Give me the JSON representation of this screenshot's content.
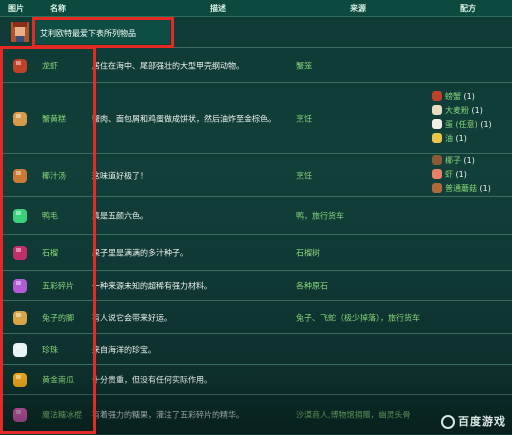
{
  "header": {
    "image": "图片",
    "name": "名称",
    "description": "描述",
    "source": "来源",
    "recipe": "配方"
  },
  "title_note": "艾利欧特最爱下表所列物品",
  "rows": [
    {
      "icon": "lobster-icon",
      "color": "#c0412a",
      "name": "龙虾",
      "desc": "居住在海中、尾部强壮的大型甲壳纲动物。",
      "src": "蟹笼"
    },
    {
      "icon": "crab-cakes-icon",
      "color": "#d69a4c",
      "name": "蟹黄糕",
      "desc": "蟹肉、面包屑和鸡蛋做成饼状，然后油炸至金棕色。",
      "src": "烹饪"
    },
    {
      "icon": "coconut-soup-icon",
      "color": "#c97a34",
      "name": "椰汁汤",
      "desc": "这味道好极了！",
      "src": "烹饪"
    },
    {
      "icon": "duck-feather-icon",
      "color": "#3bd07a",
      "name": "鸭毛",
      "desc": "真是五颜六色。",
      "src": "鸭，旅行货车"
    },
    {
      "icon": "pomegranate-icon",
      "color": "#c12f6a",
      "name": "石榴",
      "desc": "果子里是满满的多汁种子。",
      "src": "石榴树"
    },
    {
      "icon": "prismatic-shard-icon",
      "color": "#b35ad6",
      "name": "五彩碎片",
      "desc": "一种来源未知的超稀有强力材料。",
      "src": "各种原石"
    },
    {
      "icon": "rabbits-foot-icon",
      "color": "#d7a44a",
      "name": "兔子的脚",
      "desc": "有人说它会带来好运。",
      "src": "兔子、飞蛇（极少掉落），旅行货车"
    },
    {
      "icon": "pearl-icon",
      "color": "#e8f3f6",
      "name": "珍珠",
      "desc": "来自海洋的珍宝。",
      "src": ""
    },
    {
      "icon": "golden-pumpkin-icon",
      "color": "#e8a41d",
      "name": "黄金南瓜",
      "desc": "十分贵重，但没有任何实际作用。",
      "src": ""
    },
    {
      "icon": "rock-candy-icon",
      "color": "#ec5ac0",
      "name": "魔法糖冰棍",
      "desc": "有着强力的糖果，灌注了五彩碎片的精华。",
      "src": "沙漠商人,博物馆捐赠，幽灵头骨"
    }
  ],
  "recipes": [
    {
      "row": 1,
      "items": [
        {
          "label": "螃蟹",
          "qty": "(1)",
          "color": "#c0412a",
          "icon": "crab-icon"
        },
        {
          "label": "大麦粉",
          "qty": "(1)",
          "color": "#e8dcc0",
          "icon": "wheat-flour-icon"
        },
        {
          "label": "蛋 (任意)",
          "qty": "(1)",
          "color": "#f2f0e6",
          "icon": "egg-icon"
        },
        {
          "label": "油",
          "qty": "(1)",
          "color": "#e8c44a",
          "icon": "oil-icon"
        }
      ]
    },
    {
      "row": 2,
      "items": [
        {
          "label": "椰子",
          "qty": "(1)",
          "color": "#8a5a34",
          "icon": "coconut-icon"
        },
        {
          "label": "虾",
          "qty": "(1)",
          "color": "#e8806a",
          "icon": "shrimp-icon"
        },
        {
          "label": "普通蘑菇",
          "qty": "(1)",
          "color": "#b06a3a",
          "icon": "mushroom-icon"
        }
      ]
    }
  ],
  "watermark": "百度游戏",
  "colors": {
    "accent_green": "#88d478",
    "highlight_red": "#e52a26"
  }
}
